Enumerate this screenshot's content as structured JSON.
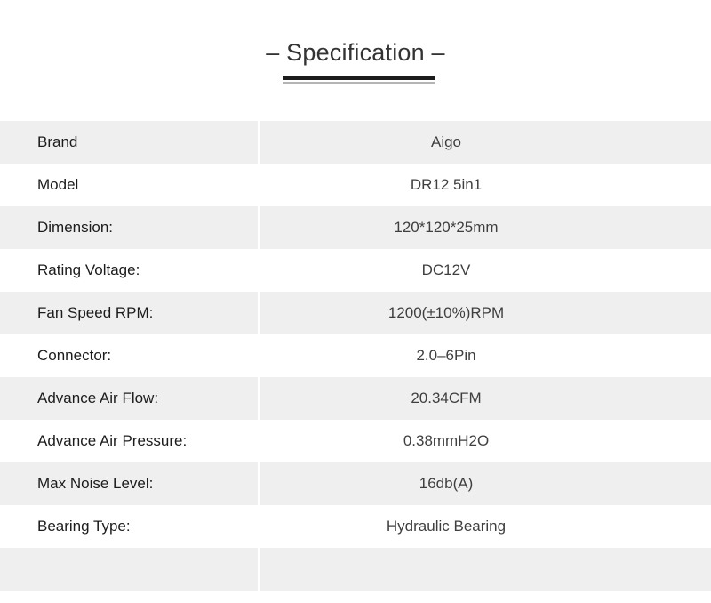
{
  "header": {
    "title": "– Specification –",
    "rule": {
      "thick_color": "#1c1c1c",
      "thin_color": "#b4b4b4"
    }
  },
  "theme": {
    "background": "#ffffff",
    "row_shaded": "#efefef",
    "row_plain": "#ffffff",
    "label_color": "#1c1c1c",
    "value_color": "#3f3f3f",
    "title_color": "#333333"
  },
  "spec_table": {
    "rows": [
      {
        "label": "Brand",
        "value": "Aigo"
      },
      {
        "label": "Model",
        "value": "DR12 5in1"
      },
      {
        "label": "Dimension:",
        "value": "120*120*25mm"
      },
      {
        "label": "Rating Voltage:",
        "value": "DC12V"
      },
      {
        "label": "Fan Speed RPM:",
        "value": "1200(±10%)RPM"
      },
      {
        "label": "Connector:",
        "value": "2.0–6Pin"
      },
      {
        "label": "Advance Air Flow:",
        "value": "20.34CFM"
      },
      {
        "label": "Advance Air Pressure:",
        "value": "0.38mmH2O"
      },
      {
        "label": "Max Noise Level:",
        "value": "16db(A)"
      },
      {
        "label": "Bearing Type:",
        "value": "Hydraulic Bearing"
      },
      {
        "label": "",
        "value": ""
      }
    ]
  }
}
